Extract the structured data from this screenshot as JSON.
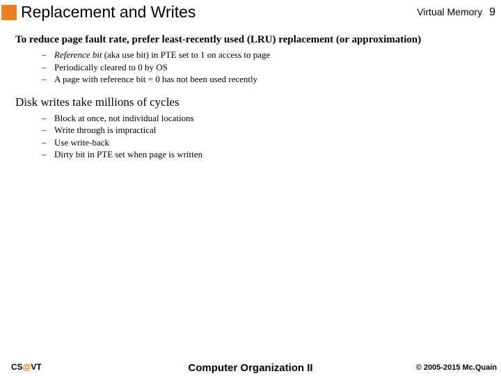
{
  "header": {
    "title": "Replacement and Writes",
    "course": "Virtual Memory",
    "page": "9"
  },
  "content": {
    "point1": "To reduce page fault rate, prefer least-recently used (LRU) replacement (or approximation)",
    "sub1": {
      "a_prefix": "Reference bit",
      "a_rest": " (aka use bit) in PTE set to 1 on access to page",
      "b": "Periodically cleared to 0 by OS",
      "c": "A page with reference bit = 0 has not been used recently"
    },
    "point2": "Disk writes take millions of cycles",
    "sub2": {
      "a": "Block at once, not individual locations",
      "b": "Write through is impractical",
      "c": "Use write-back",
      "d": "Dirty bit in PTE set when page is written"
    }
  },
  "footer": {
    "left_cs": "CS",
    "left_at": "@",
    "left_vt": "VT",
    "center": "Computer Organization II",
    "right": "© 2005-2015 Mc.Quain"
  }
}
